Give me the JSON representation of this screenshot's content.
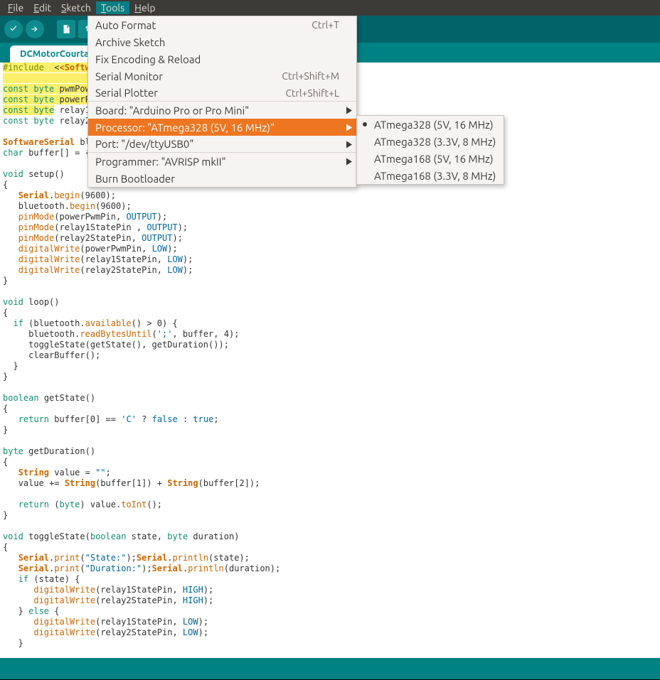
{
  "menubar": {
    "items": [
      {
        "label": "File",
        "accel": "F"
      },
      {
        "label": "Edit",
        "accel": "E"
      },
      {
        "label": "Sketch",
        "accel": "S"
      },
      {
        "label": "Tools",
        "accel": "T",
        "active": true
      },
      {
        "label": "Help",
        "accel": "H"
      }
    ]
  },
  "tab": {
    "title": "DCMotorCourtain"
  },
  "tools_menu": {
    "items": [
      {
        "label": "Auto Format",
        "shortcut": "Ctrl+T"
      },
      {
        "label": "Archive Sketch",
        "shortcut": ""
      },
      {
        "label": "Fix Encoding & Reload",
        "shortcut": ""
      },
      {
        "label": "Serial Monitor",
        "shortcut": "Ctrl+Shift+M"
      },
      {
        "label": "Serial Plotter",
        "shortcut": "Ctrl+Shift+L",
        "sep": true
      },
      {
        "label": "Board: \"Arduino Pro or Pro Mini\"",
        "submenu": true
      },
      {
        "label": "Processor: \"ATmega328 (5V, 16 MHz)\"",
        "submenu": true,
        "highlight": true
      },
      {
        "label": "Port: \"/dev/ttyUSB0\"",
        "submenu": true,
        "sep": true
      },
      {
        "label": "Programmer: \"AVRISP mkII\"",
        "submenu": true
      },
      {
        "label": "Burn Bootloader",
        "shortcut": ""
      }
    ]
  },
  "processor_submenu": {
    "items": [
      {
        "label": "ATmega328 (5V, 16 MHz)",
        "selected": true
      },
      {
        "label": "ATmega328 (3.3V, 8 MHz)",
        "selected": false
      },
      {
        "label": "ATmega168 (5V, 16 MHz)",
        "selected": false
      },
      {
        "label": "ATmega168 (3.3V, 8 MHz)",
        "selected": false
      }
    ]
  },
  "code": {
    "l01a": "#include",
    "l01b": "<Softwar",
    "l02a": "const",
    "l02b": "byte",
    "l02c": "pwmPow",
    "l03": "powerP",
    "l04": "relay1",
    "l05": "relay2",
    "l06a": "SoftwareSerial",
    "l06b": "bl",
    "l07a": "char",
    "l07b": "buffer[] = {",
    "setup": "setup",
    "loop": "loop",
    "serial": "Serial",
    "begin": "begin",
    "n9600": "9600",
    "bt": "bluetooth",
    "pinmode": "pinMode",
    "output": "OUTPUT",
    "dw": "digitalWrite",
    "low": "LOW",
    "high": "HIGH",
    "ppp": "powerPwmPin",
    "r1": "relay1StatePin",
    "r2": "relay2StatePin",
    "avail": "available",
    "rbu": "readBytesUntil",
    "buf": "buffer",
    "ts": "toggleState",
    "gs": "getState",
    "gd": "getDuration",
    "cb": "clearBuffer",
    "bool": "boolean",
    "byte": "byte",
    "void": "void",
    "const": "const",
    "ret": "return",
    "false": "false",
    "true": "true",
    "string": "String",
    "value": "value",
    "toint": "toInt",
    "print": "print",
    "println": "println",
    "sstate": "\"State:\"",
    "sdur": "\"Duration:\"",
    "semi": "';'",
    "cchar": "'C'",
    "n0": "0",
    "n1": "1",
    "n2": "2",
    "n4": "4",
    "if": "if",
    "else": "else",
    "state": "state",
    "duration": "duration",
    "empty": "\"\""
  }
}
